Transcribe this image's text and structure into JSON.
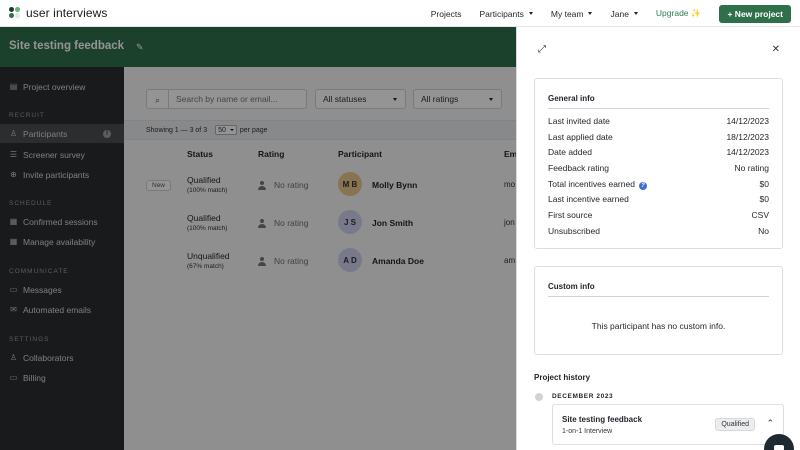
{
  "brand": {
    "name": "user interviews",
    "colors": [
      "#1f3a2c",
      "#2f6f4a",
      "#63b37a",
      "#d7ecdf"
    ]
  },
  "topnav": {
    "links": [
      {
        "label": "Projects",
        "caret": false
      },
      {
        "label": "Participants",
        "caret": true
      },
      {
        "label": "My team",
        "caret": true
      },
      {
        "label": "Jane",
        "caret": true
      }
    ],
    "upgrade": "Upgrade ✨",
    "new_project": "+ New project"
  },
  "project": {
    "title": "Site testing feedback",
    "edit_icon": "pencil-icon"
  },
  "sidebar": {
    "overview": "Project overview",
    "sections": {
      "recruit": "RECRUIT",
      "schedule": "SCHEDULE",
      "communicate": "COMMUNICATE",
      "settings": "SETTINGS"
    },
    "items": {
      "participants": "Participants",
      "participants_badge": "!",
      "screener": "Screener survey",
      "invite": "Invite participants",
      "confirmed": "Confirmed sessions",
      "availability": "Manage availability",
      "messages": "Messages",
      "automated": "Automated emails",
      "collaborators": "Collaborators",
      "billing": "Billing"
    }
  },
  "filters": {
    "search_placeholder": "Search by name or email...",
    "status": "All statuses",
    "rating": "All ratings"
  },
  "pagination": {
    "showing": "Showing 1 — 3 of 3",
    "per_page_value": "50",
    "per_page_label": "per page"
  },
  "table": {
    "headers": {
      "status": "Status",
      "rating": "Rating",
      "participant": "Participant",
      "email": "Em"
    },
    "rows": [
      {
        "badge": "New",
        "status": "Qualified",
        "match": "(100% match)",
        "rating": "No rating",
        "initials": "M B",
        "name": "Molly Bynn",
        "email": "mo"
      },
      {
        "badge": "",
        "status": "Qualified",
        "match": "(100% match)",
        "rating": "No rating",
        "initials": "J S",
        "name": "Jon Smith",
        "email": "jon"
      },
      {
        "badge": "",
        "status": "Unqualified",
        "match": "(67% match)",
        "rating": "No rating",
        "initials": "A D",
        "name": "Amanda Doe",
        "email": "am"
      }
    ]
  },
  "panel": {
    "general": {
      "title": "General info",
      "rows": [
        {
          "label": "Last invited date",
          "value": "14/12/2023"
        },
        {
          "label": "Last applied date",
          "value": "18/12/2023"
        },
        {
          "label": "Date added",
          "value": "14/12/2023"
        },
        {
          "label": "Feedback rating",
          "value": "No rating"
        },
        {
          "label": "Total incentives earned",
          "value": "$0"
        },
        {
          "label": "Last incentive earned",
          "value": "$0"
        },
        {
          "label": "First source",
          "value": "CSV"
        },
        {
          "label": "Unsubscribed",
          "value": "No"
        }
      ]
    },
    "custom": {
      "title": "Custom info",
      "empty": "This participant has no custom info."
    },
    "history": {
      "title": "Project history",
      "month": "DECEMBER 2023",
      "entry_title": "Site testing feedback",
      "entry_sub": "1-on-1 Interview",
      "entry_status": "Qualified"
    }
  }
}
